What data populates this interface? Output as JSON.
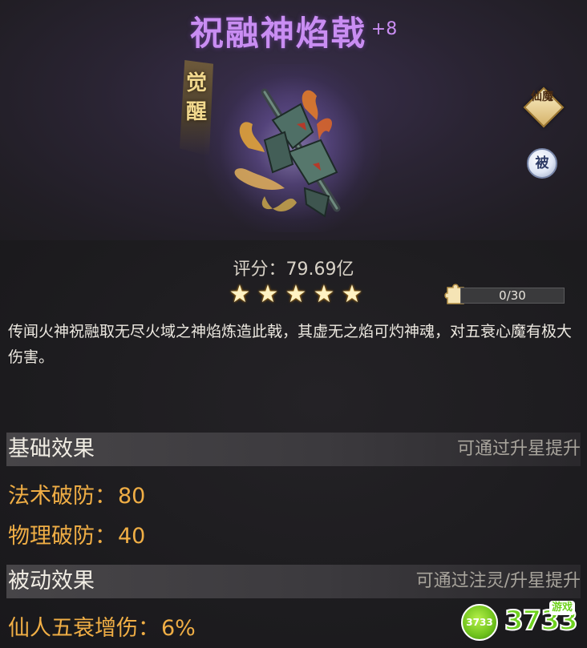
{
  "item": {
    "name": "祝融神焰戟",
    "enhance_level": "+8",
    "awaken_label": "觉醒",
    "badge_xianmo": "仙魔",
    "badge_passive": "被",
    "score_label": "评分：",
    "score_value": "79.69亿",
    "stars": 5,
    "fragment_progress": "0/30",
    "fragment_fraction": 0,
    "description": "传闻火神祝融取无尽火域之神焰炼造此戟，其虚无之焰可灼神魂，对五衰心魔有极大伤害。"
  },
  "basic_effects": {
    "title": "基础效果",
    "note": "可通过升星提升",
    "attributes": [
      {
        "name": "法术破防",
        "value": "80"
      },
      {
        "name": "物理破防",
        "value": "40"
      }
    ]
  },
  "passive_effects": {
    "title": "被动效果",
    "note": "可通过注灵/升星提升",
    "attributes": [
      {
        "name": "仙人五衰增伤",
        "value": "6%"
      }
    ]
  },
  "watermark": {
    "circle_text": "3733",
    "brand_text": "3733",
    "sub_text": "游戏"
  },
  "colors": {
    "title": "#c98df2",
    "attribute": "#f0ae45",
    "note": "#a8a49c"
  },
  "icons": {
    "weapon": "halberd-icon",
    "star": "star-icon",
    "fragment": "puzzle-fragment-icon"
  }
}
